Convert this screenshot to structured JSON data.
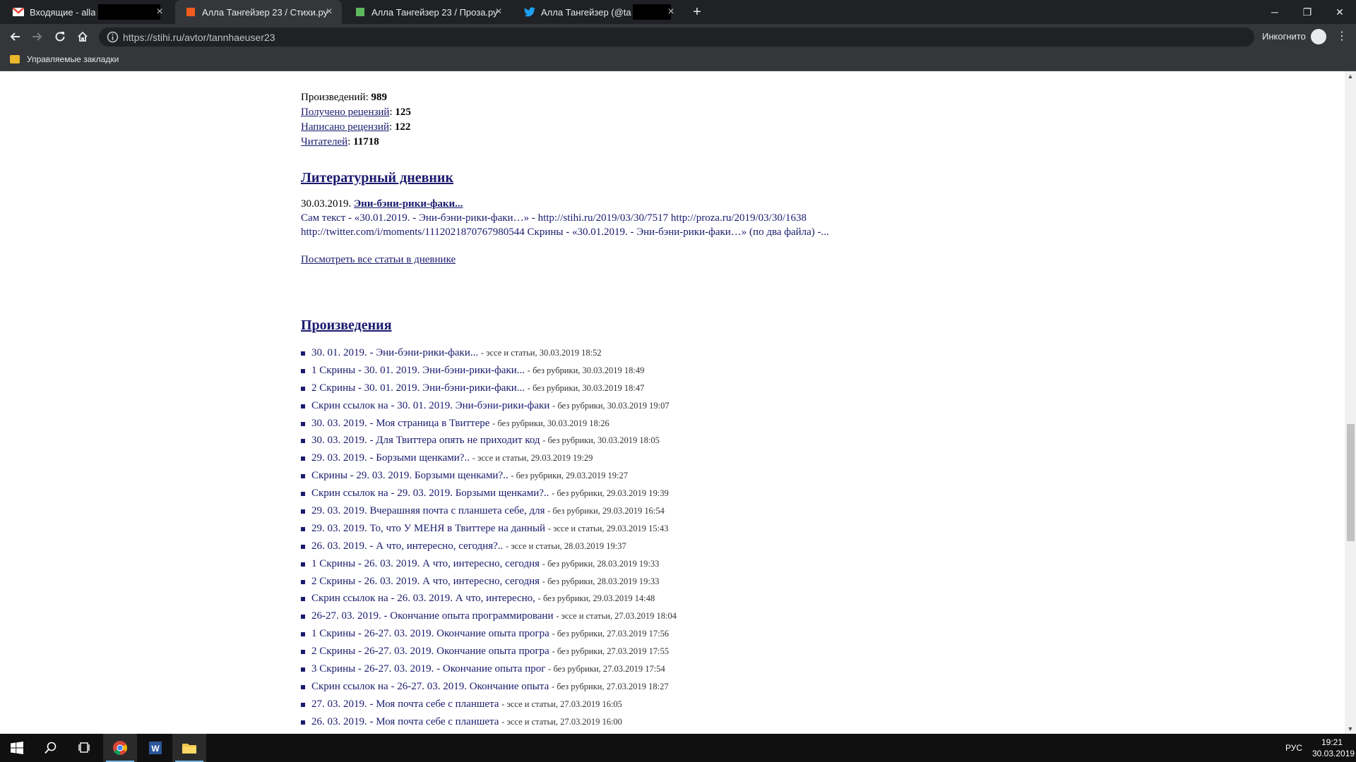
{
  "browser": {
    "tabs": [
      {
        "title": "Входящие - alla",
        "favicon": "gmail-icon",
        "redacted": true
      },
      {
        "title": "Алла Тангейзер 23 / Стихи.ру",
        "favicon": "stihi-icon",
        "active": true
      },
      {
        "title": "Алла Тангейзер 23 / Проза.ру",
        "favicon": "proza-icon"
      },
      {
        "title": "Алла Тангейзер (@ta",
        "favicon": "twitter-icon",
        "redacted": true
      }
    ],
    "url": "https://stihi.ru/avtor/tannhaeuser23",
    "incognito_label": "Инкогнито",
    "bookmark_folder": "Управляемые закладки"
  },
  "stats": {
    "works_label": "Произведений",
    "works_value": "989",
    "received_label": "Получено рецензий",
    "received_value": "125",
    "written_label": "Написано рецензий",
    "written_value": "122",
    "readers_label": "Читателей",
    "readers_value": "11718"
  },
  "diary": {
    "heading": "Литературный дневник",
    "date": "30.03.2019.",
    "title": "Эни-бэни-рики-факи...",
    "text_line1": "Сам текст - «30.01.2019. - Эни-бэни-рики-факи…» - http://stihi.ru/2019/03/30/7517 http://proza.ru/2019/03/30/1638",
    "text_line2": "http://twitter.com/i/moments/1112021870767980544 Скрины - «30.01.2019. - Эни-бэни-рики-факи…» (по два файла) -...",
    "all_link": "Посмотреть все статьи в дневнике"
  },
  "works": {
    "heading": "Произведения",
    "items": [
      {
        "title": "30. 01. 2019. - Эни-бэни-рики-факи...",
        "meta": "- эссе и статьи, 30.03.2019 18:52"
      },
      {
        "title": "1 Скрины - 30. 01. 2019. Эни-бэни-рики-факи...",
        "meta": "- без рубрики, 30.03.2019 18:49"
      },
      {
        "title": "2 Скрины - 30. 01. 2019. Эни-бэни-рики-факи...",
        "meta": "- без рубрики, 30.03.2019 18:47"
      },
      {
        "title": "Скрин ссылок на - 30. 01. 2019. Эни-бэни-рики-факи",
        "meta": "- без рубрики, 30.03.2019 19:07"
      },
      {
        "title": "30. 03. 2019. - Моя страница в Твиттере",
        "meta": "- без рубрики, 30.03.2019 18:26"
      },
      {
        "title": "30. 03. 2019. - Для Твиттера опять не приходит код",
        "meta": "- без рубрики, 30.03.2019 18:05"
      },
      {
        "title": "29. 03. 2019. - Борзыми щенками?..",
        "meta": "- эссе и статьи, 29.03.2019 19:29"
      },
      {
        "title": "Скрины - 29. 03. 2019. Борзыми щенками?..",
        "meta": "- без рубрики, 29.03.2019 19:27"
      },
      {
        "title": "Скрин ссылок на - 29. 03. 2019. Борзыми щенками?..",
        "meta": "- без рубрики, 29.03.2019 19:39"
      },
      {
        "title": "29. 03. 2019. Вчерашняя почта с планшета себе, для",
        "meta": "- без рубрики, 29.03.2019 16:54"
      },
      {
        "title": "29. 03. 2019. То, что У МЕНЯ в Твиттере на данный",
        "meta": "- эссе и статьи, 29.03.2019 15:43"
      },
      {
        "title": "26. 03. 2019. - А что, интересно, сегодня?..",
        "meta": "- эссе и статьи, 28.03.2019 19:37"
      },
      {
        "title": "1 Скрины - 26. 03. 2019. А что, интересно, сегодня",
        "meta": "- без рубрики, 28.03.2019 19:33"
      },
      {
        "title": "2 Скрины - 26. 03. 2019. А что, интересно, сегодня",
        "meta": "- без рубрики, 28.03.2019 19:33"
      },
      {
        "title": "Скрин ссылок на - 26. 03. 2019. А что, интересно,",
        "meta": "- без рубрики, 29.03.2019 14:48"
      },
      {
        "title": "26-27. 03. 2019. - Окончание опыта программировани",
        "meta": "- эссе и статьи, 27.03.2019 18:04"
      },
      {
        "title": "1 Скрины - 26-27. 03. 2019. Окончание опыта програ",
        "meta": "- без рубрики, 27.03.2019 17:56"
      },
      {
        "title": "2 Скрины - 26-27. 03. 2019. Окончание опыта програ",
        "meta": "- без рубрики, 27.03.2019 17:55"
      },
      {
        "title": "3 Скрины - 26-27. 03. 2019. - Окончание опыта прог",
        "meta": "- без рубрики, 27.03.2019 17:54"
      },
      {
        "title": "Скрин ссылок на - 26-27. 03. 2019. Окончание опыта",
        "meta": "- без рубрики, 27.03.2019 18:27"
      },
      {
        "title": "27. 03. 2019. - Моя почта себе с планшета",
        "meta": "- эссе и статьи, 27.03.2019 16:05"
      },
      {
        "title": "26. 03. 2019. - Моя почта себе с планшета",
        "meta": "- эссе и статьи, 27.03.2019 16:00"
      }
    ]
  },
  "taskbar": {
    "apps": [
      "start-icon",
      "search-icon",
      "task-view-icon",
      "chrome-icon",
      "word-icon",
      "explorer-icon"
    ],
    "language": "РУС",
    "time": "19:21",
    "date": "30.03.2019"
  }
}
